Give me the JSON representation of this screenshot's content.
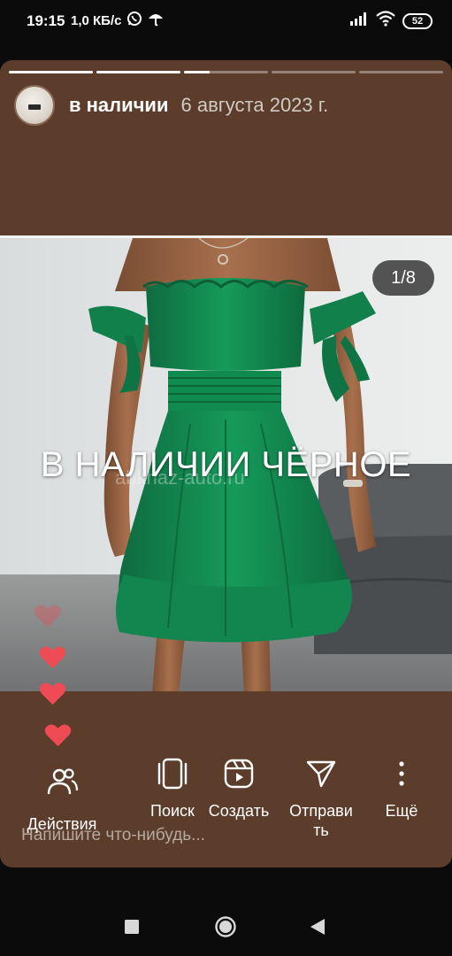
{
  "status_bar": {
    "time": "19:15",
    "speed": "1,0 КБ/с",
    "battery": "52",
    "icons": [
      "whatsapp-icon",
      "umbrella-icon",
      "signal-icon",
      "wifi-icon",
      "battery-icon"
    ]
  },
  "story": {
    "progress_segments": 5,
    "progress_fill": [
      1,
      1,
      0.3,
      0,
      0
    ],
    "username": "в наличии",
    "date": "6 августа 2023 г.",
    "counter": "1/8",
    "caption": "В НАЛИЧИИ ЧЁРНОЕ",
    "watermark": "abkhaz-auto.ru",
    "reply_placeholder": "Напишите что-нибудь...",
    "background_color": "#5c3d2b",
    "heart_color": "#ef4b55"
  },
  "actions": [
    {
      "label": "Действия",
      "icon": "people-icon"
    },
    {
      "label": "Поиск",
      "icon": "carousel-icon"
    },
    {
      "label": "Создать",
      "icon": "reels-icon"
    },
    {
      "label": "Отправить",
      "label_line1": "Отправи",
      "label_line2": "ть",
      "icon": "send-icon"
    },
    {
      "label": "Ещё",
      "icon": "more-icon"
    }
  ],
  "navbar": {
    "icons": [
      "recents-square-icon",
      "home-circle-icon",
      "back-triangle-icon"
    ]
  }
}
